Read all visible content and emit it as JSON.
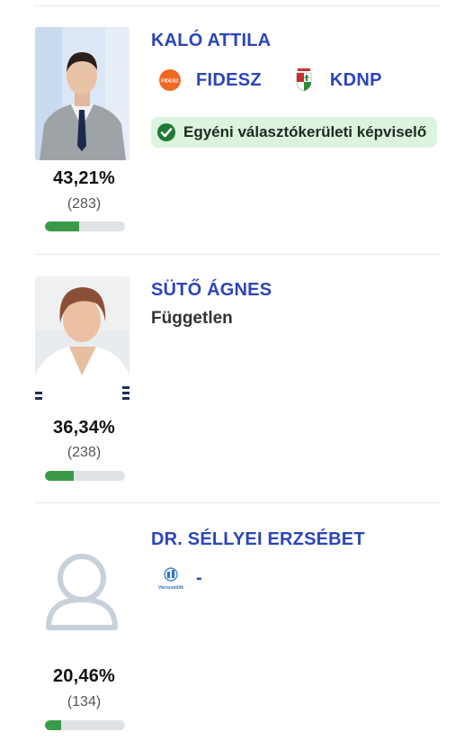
{
  "candidates": [
    {
      "name": "KALÓ ATTILA",
      "parties": [
        {
          "name": "FIDESZ",
          "logo_icon": "fidesz-logo-icon",
          "logo_text": "FIDESZ"
        },
        {
          "name": "KDNP",
          "logo_icon": "kdnp-logo-icon"
        }
      ],
      "badge": "Egyéni választókerületi képviselő",
      "percent_label": "43,21%",
      "votes_label": "(283)",
      "percent": 43.21
    },
    {
      "name": "SÜTŐ ÁGNES",
      "affiliation": "Független",
      "percent_label": "36,34%",
      "votes_label": "(238)",
      "percent": 36.34
    },
    {
      "name": "DR. SÉLLYEI ERZSÉBET",
      "parties": [
        {
          "name": "-",
          "logo_icon": "varosvedok-logo-icon",
          "logo_text": "Városvédők"
        }
      ],
      "photo_icon": "user-placeholder-icon",
      "percent_label": "20,46%",
      "votes_label": "(134)",
      "percent": 20.46
    }
  ],
  "colors": {
    "name": "#2c45b8",
    "bar_fill": "#3b9a4a",
    "bar_track": "#dfe2e6",
    "badge_bg": "#dcf3dd",
    "check": "#1e7a34",
    "fidesz": "#f26722"
  }
}
